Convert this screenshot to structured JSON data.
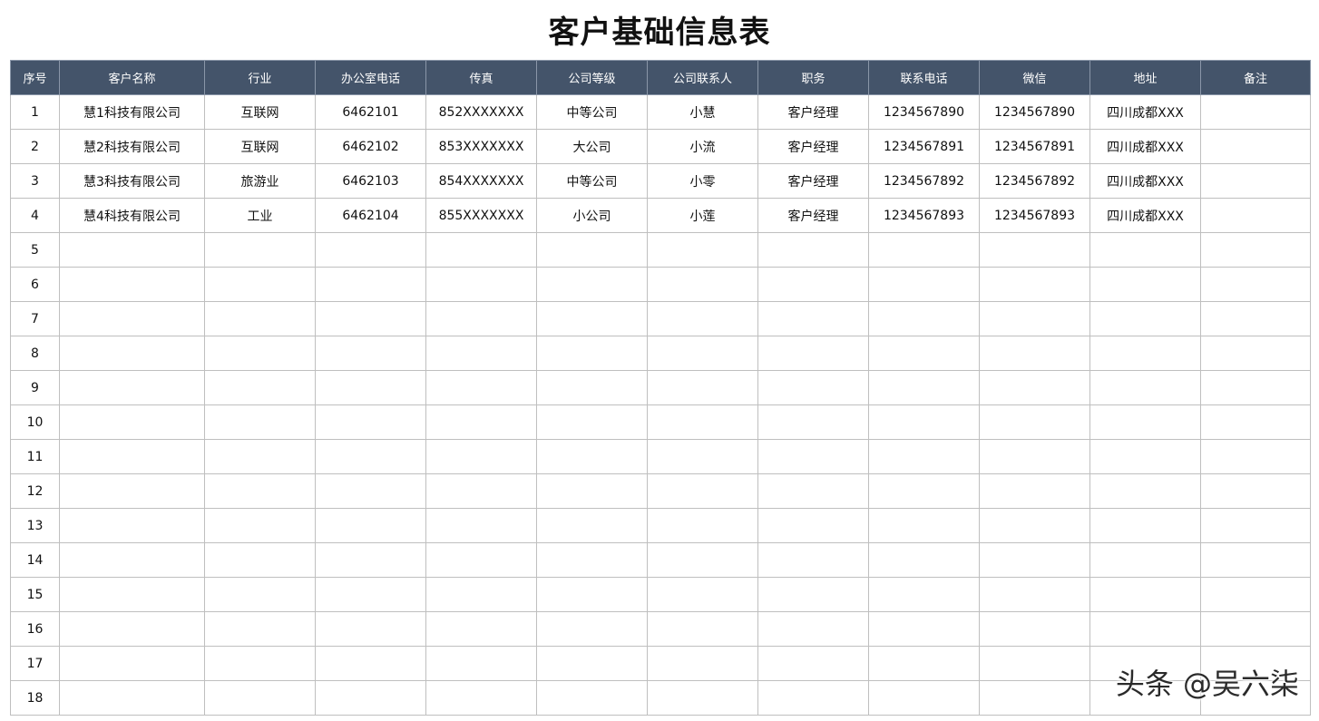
{
  "title": "客户基础信息表",
  "columns": [
    "序号",
    "客户名称",
    "行业",
    "办公室电话",
    "传真",
    "公司等级",
    "公司联系人",
    "职务",
    "联系电话",
    "微信",
    "地址",
    "备注"
  ],
  "rows": [
    [
      "1",
      "慧1科技有限公司",
      "互联网",
      "6462101",
      "852XXXXXXX",
      "中等公司",
      "小慧",
      "客户经理",
      "1234567890",
      "1234567890",
      "四川成都XXX",
      ""
    ],
    [
      "2",
      "慧2科技有限公司",
      "互联网",
      "6462102",
      "853XXXXXXX",
      "大公司",
      "小流",
      "客户经理",
      "1234567891",
      "1234567891",
      "四川成都XXX",
      ""
    ],
    [
      "3",
      "慧3科技有限公司",
      "旅游业",
      "6462103",
      "854XXXXXXX",
      "中等公司",
      "小零",
      "客户经理",
      "1234567892",
      "1234567892",
      "四川成都XXX",
      ""
    ],
    [
      "4",
      "慧4科技有限公司",
      "工业",
      "6462104",
      "855XXXXXXX",
      "小公司",
      "小莲",
      "客户经理",
      "1234567893",
      "1234567893",
      "四川成都XXX",
      ""
    ],
    [
      "5",
      "",
      "",
      "",
      "",
      "",
      "",
      "",
      "",
      "",
      "",
      ""
    ],
    [
      "6",
      "",
      "",
      "",
      "",
      "",
      "",
      "",
      "",
      "",
      "",
      ""
    ],
    [
      "7",
      "",
      "",
      "",
      "",
      "",
      "",
      "",
      "",
      "",
      "",
      ""
    ],
    [
      "8",
      "",
      "",
      "",
      "",
      "",
      "",
      "",
      "",
      "",
      "",
      ""
    ],
    [
      "9",
      "",
      "",
      "",
      "",
      "",
      "",
      "",
      "",
      "",
      "",
      ""
    ],
    [
      "10",
      "",
      "",
      "",
      "",
      "",
      "",
      "",
      "",
      "",
      "",
      ""
    ],
    [
      "11",
      "",
      "",
      "",
      "",
      "",
      "",
      "",
      "",
      "",
      "",
      ""
    ],
    [
      "12",
      "",
      "",
      "",
      "",
      "",
      "",
      "",
      "",
      "",
      "",
      ""
    ],
    [
      "13",
      "",
      "",
      "",
      "",
      "",
      "",
      "",
      "",
      "",
      "",
      ""
    ],
    [
      "14",
      "",
      "",
      "",
      "",
      "",
      "",
      "",
      "",
      "",
      "",
      ""
    ],
    [
      "15",
      "",
      "",
      "",
      "",
      "",
      "",
      "",
      "",
      "",
      "",
      ""
    ],
    [
      "16",
      "",
      "",
      "",
      "",
      "",
      "",
      "",
      "",
      "",
      "",
      ""
    ],
    [
      "17",
      "",
      "",
      "",
      "",
      "",
      "",
      "",
      "",
      "",
      "",
      ""
    ],
    [
      "18",
      "",
      "",
      "",
      "",
      "",
      "",
      "",
      "",
      "",
      "",
      ""
    ]
  ],
  "watermark": "头条 @吴六柒",
  "colors": {
    "header_bg": "#44546a",
    "header_text": "#ffffff",
    "grid": "#bfbfbf"
  }
}
